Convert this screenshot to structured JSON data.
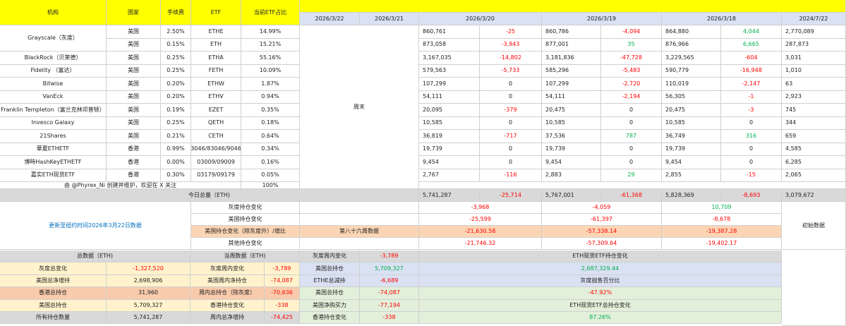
{
  "header": {
    "institution": "机构",
    "country": "国家",
    "fee": "手续费",
    "etf": "ETF",
    "share": "当前ETF占比",
    "dates": [
      "2026/3/22",
      "2026/3/21",
      "2026/3/20",
      "2026/3/19",
      "2026/3/18",
      "2024/7/22"
    ]
  },
  "rows": [
    {
      "name": "Grayscale（灰度）",
      "country": "美国",
      "fee": "2.50%",
      "etf": "ETHE",
      "share": "14.99%",
      "d0320": "860,761",
      "c0320": "-25",
      "d0319": "860,786",
      "c0319": "-4,094",
      "d0318": "864,880",
      "c0318": "4,044",
      "d0722": "2,770,089"
    },
    {
      "name": "",
      "country": "美国",
      "fee": "0.15%",
      "etf": "ETH",
      "share": "15.21%",
      "d0320": "873,058",
      "c0320": "-3,943",
      "d0319": "877,001",
      "c0319": "35",
      "d0318": "876,966",
      "c0318": "6,665",
      "d0722": "287,873"
    },
    {
      "name": "BlackRock（贝莱德）",
      "country": "美国",
      "fee": "0.25%",
      "etf": "ETHA",
      "share": "55.16%",
      "d0320": "3,167,035",
      "c0320": "-14,802",
      "d0319": "3,181,836",
      "c0319": "-47,728",
      "d0318": "3,229,565",
      "c0318": "-604",
      "d0722": "3,031"
    },
    {
      "name": "Fidelity （富达）",
      "country": "美国",
      "fee": "0.25%",
      "etf": "FETH",
      "share": "10.09%",
      "d0320": "579,563",
      "c0320": "-5,733",
      "d0319": "585,296",
      "c0319": "-5,483",
      "d0318": "590,779",
      "c0318": "-16,948",
      "d0722": "1,010"
    },
    {
      "name": "Bitwise",
      "country": "美国",
      "fee": "0.20%",
      "etf": "ETHW",
      "share": "1.87%",
      "d0320": "107,299",
      "c0320": "0",
      "d0319": "107,299",
      "c0319": "-2,720",
      "d0318": "110,019",
      "c0318": "-2,147",
      "d0722": "63"
    },
    {
      "name": "VanEck",
      "country": "美国",
      "fee": "0.20%",
      "etf": "ETHV",
      "share": "0.94%",
      "d0320": "54,111",
      "c0320": "0",
      "d0319": "54,111",
      "c0319": "-2,194",
      "d0318": "56,305",
      "c0318": "-1",
      "d0722": "2,923"
    },
    {
      "name": "Franklin Templeton（富兰克林邓普顿）",
      "country": "美国",
      "fee": "0.19%",
      "etf": "EZET",
      "share": "0.35%",
      "d0320": "20,095",
      "c0320": "-379",
      "d0319": "20,475",
      "c0319": "0",
      "d0318": "20,475",
      "c0318": "-3",
      "d0722": "745"
    },
    {
      "name": "Invesco Galaxy",
      "country": "美国",
      "fee": "0.25%",
      "etf": "QETH",
      "share": "0.18%",
      "d0320": "10,585",
      "c0320": "0",
      "d0319": "10,585",
      "c0319": "0",
      "d0318": "10,585",
      "c0318": "0",
      "d0722": "344"
    },
    {
      "name": "21Shares",
      "country": "美国",
      "fee": "0.21%",
      "etf": "CETH",
      "share": "0.64%",
      "d0320": "36,819",
      "c0320": "-717",
      "d0319": "37,536",
      "c0319": "787",
      "d0318": "36,749",
      "c0318": "316",
      "d0722": "659"
    },
    {
      "name": "華夏ETHETF",
      "country": "香港",
      "fee": "0.99%",
      "etf": "3046/83046/9046",
      "share": "0.34%",
      "d0320": "19,739",
      "c0320": "0",
      "d0319": "19,739",
      "c0319": "0",
      "d0318": "19,739",
      "c0318": "0",
      "d0722": "4,585"
    },
    {
      "name": "博時HashKeyETHETF",
      "country": "香港",
      "fee": "0.00%",
      "etf": "03009/09009",
      "share": "0.16%",
      "d0320": "9,454",
      "c0320": "0",
      "d0319": "9,454",
      "c0319": "0",
      "d0318": "9,454",
      "c0318": "0",
      "d0722": "6,285"
    },
    {
      "name": "嘉实ETH现货ETF",
      "country": "香港",
      "fee": "0.30%",
      "etf": "03179/09179",
      "share": "0.05%",
      "d0320": "2,767",
      "c0320": "-116",
      "d0319": "2,883",
      "c0319": "29",
      "d0318": "2,855",
      "c0318": "-15",
      "d0722": "2,065"
    }
  ],
  "credit": "由 @Phyrex_Ni 创建并维护，欢迎在 X 关注",
  "credit_pct": "100%",
  "weekend": "周末",
  "total": {
    "label": "今日总量（ETH)",
    "d0320": "5,741,287",
    "c0320": "-25,714",
    "d0319": "5,767,001",
    "c0319": "-61,368",
    "d0318": "5,828,369",
    "c0318": "-8,693",
    "d0722": "3,079,672"
  },
  "update_note": "更新至纽约时间2026年3月22日数据",
  "initial": "初始数据",
  "week_label": "第八十六周数据",
  "changes": [
    {
      "label": "灰度持仓变化",
      "v0320": "-3,968",
      "v0319": "-4,059",
      "v0318": "10,709"
    },
    {
      "label": "美国持仓变化",
      "v0320": "-25,599",
      "v0319": "-61,397",
      "v0318": "-8,678"
    },
    {
      "label": "美国持仓变化（除灰度外）/增比",
      "v0320": "-21,630.58",
      "v0319": "-57,338.14",
      "v0318": "-19,387.28"
    },
    {
      "label": "其他持仓变化",
      "v0320": "-21,746.32",
      "v0319": "-57,309.64",
      "v0318": "-19,402.17"
    }
  ],
  "summary": {
    "h_total": "总数据（ETH)",
    "h_current": "当周数据（ETH)",
    "col1": [
      {
        "label": "灰度总变化",
        "value": "-1,327,520"
      },
      {
        "label": "美国总净增持",
        "value": "2,698,906"
      },
      {
        "label": "香港总持仓",
        "value": "31,960"
      },
      {
        "label": "美国总持仓",
        "value": "5,709,327"
      },
      {
        "label": "所有持仓数量",
        "value": "5,741,287"
      }
    ],
    "col2": [
      {
        "label": "灰度周内变化",
        "value": "-3,789"
      },
      {
        "label": "美国周内净持仓",
        "value": "-74,087"
      },
      {
        "label": "周内总持仓（除灰度）",
        "value": "-70,636"
      },
      {
        "label": "香港持仓变化",
        "value": "-338"
      },
      {
        "label": "周内总净增持",
        "value": "-74,425"
      }
    ],
    "col3": [
      {
        "label": "灰度周内变化",
        "value": "-3,789"
      },
      {
        "label": "美国总持仓",
        "value": "5,709,327"
      },
      {
        "label": "ETHE总减持",
        "value": "-6,689"
      },
      {
        "label": "美国总持仓",
        "value": "-74,087"
      },
      {
        "label": "美国净购买力",
        "value": "-77,194"
      },
      {
        "label": "香港持仓变化",
        "value": "-338"
      }
    ],
    "col4": [
      {
        "label": "ETH现货ETF持仓变化"
      },
      {
        "label": "2,687,329.44"
      },
      {
        "label": "灰度抛售百分比"
      },
      {
        "label": "-47.92%"
      },
      {
        "label": "ETH现货ETF总持仓变化"
      },
      {
        "label": "87.26%"
      }
    ]
  }
}
